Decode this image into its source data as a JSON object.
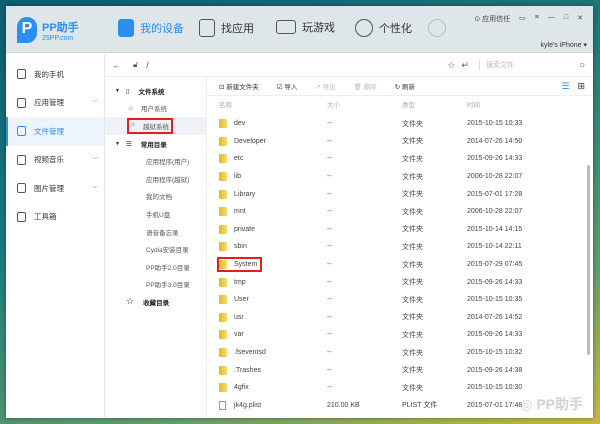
{
  "app": {
    "logo_title": "PP助手",
    "logo_sub": "25PP.com"
  },
  "nav": [
    {
      "label": "我的设备"
    },
    {
      "label": "找应用"
    },
    {
      "label": "玩游戏"
    },
    {
      "label": "个性化"
    }
  ],
  "header": {
    "trust": "应用信任",
    "device": "kyle's iPhone ▾"
  },
  "sidebar": [
    {
      "label": "我的手机"
    },
    {
      "label": "应用管理"
    },
    {
      "label": "文件管理"
    },
    {
      "label": "视频音乐"
    },
    {
      "label": "图片管理"
    },
    {
      "label": "工具箱"
    }
  ],
  "path": {
    "value": "/",
    "search_placeholder": "搜索文件"
  },
  "tree": {
    "filesystem": "文件系统",
    "user_sys": "用户系统",
    "jb_sys": "越狱系统",
    "common": "常用目录",
    "common_items": [
      "应用程序(用户)",
      "应用程序(越狱)",
      "我的文档",
      "手机U盘",
      "语音备忘录",
      "Cydia安装目录",
      "PP助手2.0目录",
      "PP助手3.0目录"
    ],
    "favorites": "收藏目录"
  },
  "toolbar": {
    "new_folder": "新建文件夹",
    "import": "导入",
    "export": "导出",
    "delete": "删除",
    "refresh": "刷新"
  },
  "columns": {
    "name": "名称",
    "size": "大小",
    "type": "类型",
    "time": "时间"
  },
  "files": [
    {
      "name": "dev",
      "size": "--",
      "type": "文件夹",
      "time": "2015-10-15 10:33"
    },
    {
      "name": "Developer",
      "size": "--",
      "type": "文件夹",
      "time": "2014-07-26 14:50"
    },
    {
      "name": "etc",
      "size": "--",
      "type": "文件夹",
      "time": "2015-09-26 14:33"
    },
    {
      "name": "lib",
      "size": "--",
      "type": "文件夹",
      "time": "2006-10-28 22:07"
    },
    {
      "name": "Library",
      "size": "--",
      "type": "文件夹",
      "time": "2015-07-01 17:28"
    },
    {
      "name": "mnt",
      "size": "--",
      "type": "文件夹",
      "time": "2006-10-28 22:07"
    },
    {
      "name": "private",
      "size": "--",
      "type": "文件夹",
      "time": "2015-10-14 14:15"
    },
    {
      "name": "sbin",
      "size": "--",
      "type": "文件夹",
      "time": "2015-10-14 22:11"
    },
    {
      "name": "System",
      "size": "--",
      "type": "文件夹",
      "time": "2015-07-29 07:45"
    },
    {
      "name": "tmp",
      "size": "--",
      "type": "文件夹",
      "time": "2015-09-26 14:33"
    },
    {
      "name": "User",
      "size": "--",
      "type": "文件夹",
      "time": "2015-10-15 10:35"
    },
    {
      "name": "usr",
      "size": "--",
      "type": "文件夹",
      "time": "2014-07-26 14:52"
    },
    {
      "name": "var",
      "size": "--",
      "type": "文件夹",
      "time": "2015-09-26 14:33"
    },
    {
      "name": ".fseventsd",
      "size": "--",
      "type": "文件夹",
      "time": "2015-10-15 10:32"
    },
    {
      "name": ".Trashes",
      "size": "--",
      "type": "文件夹",
      "time": "2015-09-26 14:38"
    },
    {
      "name": "4gfix",
      "size": "--",
      "type": "文件夹",
      "time": "2015-10-15 10:30"
    },
    {
      "name": "jk4g.plist",
      "size": "210.00 KB",
      "type": "PLIST 文件",
      "time": "2015-07-01 17:48"
    }
  ],
  "watermark": "PP助手"
}
